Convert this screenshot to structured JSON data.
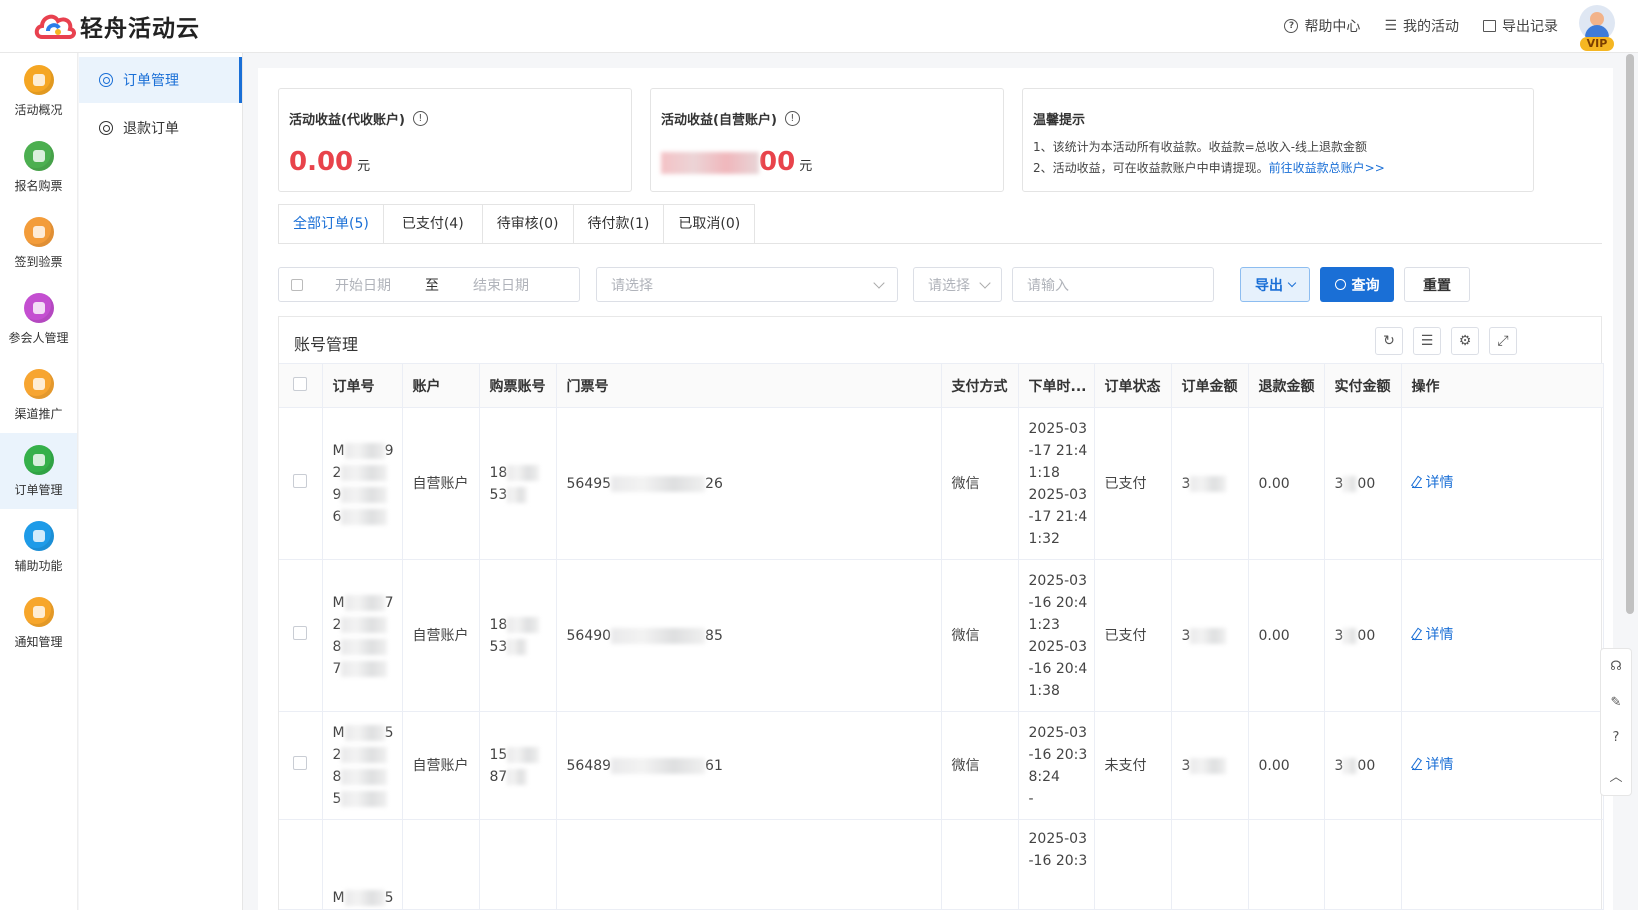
{
  "app": {
    "name": "轻舟活动云"
  },
  "topnav": [
    {
      "icon": "help-circle-icon",
      "label": "帮助中心"
    },
    {
      "icon": "list-icon",
      "label": "我的活动"
    },
    {
      "icon": "export-icon",
      "label": "导出记录"
    }
  ],
  "user": {
    "badge": "VIP"
  },
  "sidebar": {
    "items": [
      {
        "label": "活动概况",
        "color": "#f5a623"
      },
      {
        "label": "报名购票",
        "color": "#4caf50"
      },
      {
        "label": "签到验票",
        "color": "#f39c3a"
      },
      {
        "label": "参会人管理",
        "color": "#c44fd1"
      },
      {
        "label": "渠道推广",
        "color": "#f7a531"
      },
      {
        "label": "订单管理",
        "color": "#35b04a",
        "active": true
      },
      {
        "label": "辅助功能",
        "color": "#1e9be8"
      },
      {
        "label": "通知管理",
        "color": "#f7a62b"
      }
    ]
  },
  "subnav": {
    "items": [
      {
        "label": "订单管理"
      },
      {
        "label": "退款订单"
      }
    ]
  },
  "cards": {
    "agent": {
      "title": "活动收益(代收账户)",
      "amount": "0.00",
      "unit": "元"
    },
    "self": {
      "title": "活动收益(自营账户)",
      "amount_suffix": "00",
      "unit": "元"
    },
    "tips": {
      "title": "温馨提示",
      "line1": "1、该统计为本活动所有收益款。收益款=总收入-线上退款金额",
      "line2": "2、活动收益，可在收益款账户中申请提现。",
      "link": "前往收益款总账户>>"
    }
  },
  "tabs": [
    "全部订单(5)",
    "已支付(4)",
    "待审核(0)",
    "待付款(1)",
    "已取消(0)"
  ],
  "filters": {
    "start_placeholder": "开始日期",
    "to": "至",
    "end_placeholder": "结束日期",
    "select1_placeholder": "请选择",
    "select2_placeholder": "请选择",
    "input_placeholder": "请输入",
    "export": "导出",
    "search": "查询",
    "reset": "重置"
  },
  "table": {
    "title": "账号管理",
    "columns": [
      "订单号",
      "账户",
      "购票账号",
      "门票号",
      "支付方式",
      "下单时...",
      "订单状态",
      "订单金额",
      "退款金额",
      "实付金额",
      "操作"
    ],
    "rows": [
      {
        "order": [
          "M",
          "2",
          "9",
          "6"
        ],
        "order_end": "9",
        "account": "自营账户",
        "buyer": [
          "18",
          "53"
        ],
        "ticket_pre": "56495",
        "ticket_end": "26",
        "pay": "微信",
        "time": [
          "2025-03",
          "-17 21:4",
          "1:18",
          "2025-03",
          "-17 21:4",
          "1:32"
        ],
        "status": "已支付",
        "amount": "3",
        "refund": "0.00",
        "paid_pre": "3",
        "paid_end": "00",
        "action": "详情"
      },
      {
        "order": [
          "M",
          "2",
          "8",
          "7"
        ],
        "order_end": "7",
        "account": "自营账户",
        "buyer": [
          "18",
          "53"
        ],
        "ticket_pre": "56490",
        "ticket_end": "85",
        "pay": "微信",
        "time": [
          "2025-03",
          "-16 20:4",
          "1:23",
          "2025-03",
          "-16 20:4",
          "1:38"
        ],
        "status": "已支付",
        "amount": "3",
        "refund": "0.00",
        "paid_pre": "3",
        "paid_end": "00",
        "action": "详情"
      },
      {
        "order": [
          "M",
          "2",
          "8",
          "5"
        ],
        "order_end": "5",
        "account": "自营账户",
        "buyer": [
          "15",
          "87"
        ],
        "ticket_pre": "56489",
        "ticket_end": "61",
        "pay": "微信",
        "time": [
          "2025-03",
          "-16 20:3",
          "8:24",
          "-"
        ],
        "status": "未支付",
        "amount": "3",
        "refund": "0.00",
        "paid_pre": "3",
        "paid_end": "00",
        "action": "详情"
      },
      {
        "order": [
          "M"
        ],
        "order_end": "5",
        "account": "",
        "buyer": [],
        "ticket_pre": "",
        "ticket_end": "",
        "pay": "",
        "time": [
          "2025-03",
          "-16 20:3"
        ],
        "status": "",
        "amount": "",
        "refund": "",
        "paid_pre": "",
        "paid_end": "",
        "action": ""
      }
    ]
  }
}
